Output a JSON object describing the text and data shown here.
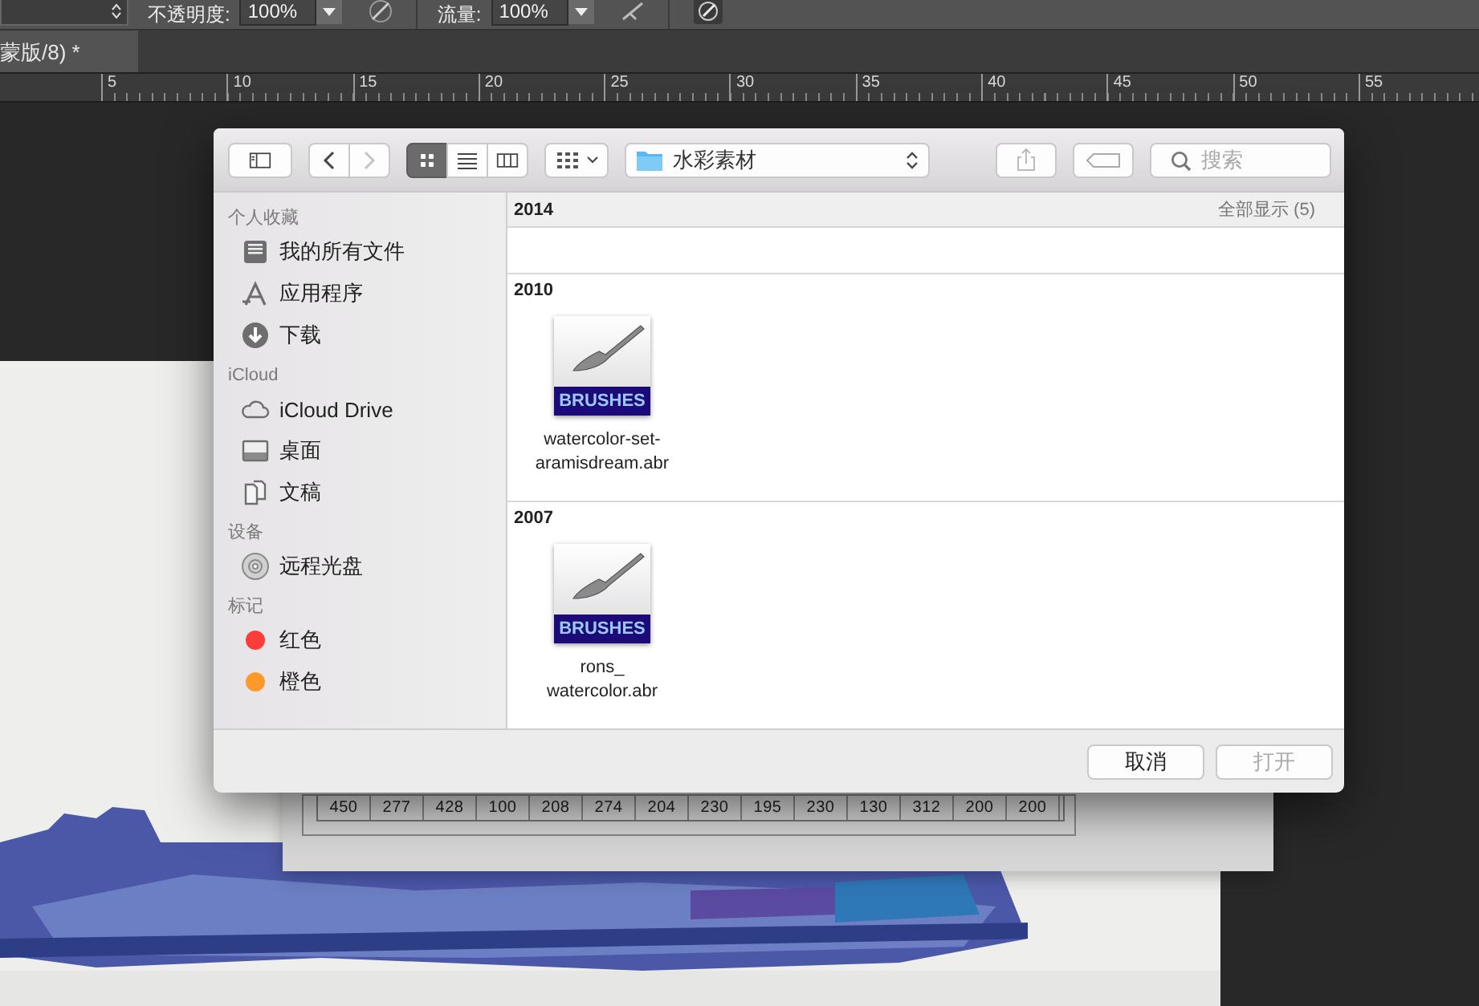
{
  "options_bar": {
    "opacity_label": "不透明度:",
    "opacity": "100%",
    "flow_label": "流量:",
    "flow": "100%"
  },
  "document_tab": {
    "title": "蒙版/8) *",
    "selected": true
  },
  "ruler": {
    "labels": [
      "5",
      "10",
      "15",
      "20",
      "25",
      "30",
      "35",
      "40",
      "45",
      "50",
      "55"
    ]
  },
  "background_table": {
    "cells": [
      "450",
      "277",
      "428",
      "100",
      "208",
      "274",
      "204",
      "230",
      "195",
      "230",
      "130",
      "312",
      "200",
      "200"
    ]
  },
  "dialog": {
    "navigation": [
      {
        "disabled": false
      },
      {
        "disabled": true
      }
    ],
    "views": [
      {
        "selected": true
      },
      {
        "selected": false
      },
      {
        "selected": false
      }
    ],
    "path": {
      "folder": "水彩素材"
    },
    "search": {
      "placeholder": "搜索"
    },
    "sidebar": [
      {
        "title": "个人收藏",
        "items": [
          {
            "kind": "place",
            "label": "我的所有文件"
          },
          {
            "kind": "place",
            "label": "应用程序"
          },
          {
            "kind": "place",
            "label": "下载"
          }
        ]
      },
      {
        "title": "iCloud",
        "items": [
          {
            "kind": "place",
            "label": "iCloud Drive"
          },
          {
            "kind": "place",
            "label": "桌面"
          },
          {
            "kind": "place",
            "label": "文稿"
          }
        ]
      },
      {
        "title": "设备",
        "items": [
          {
            "kind": "place",
            "label": "远程光盘"
          }
        ]
      },
      {
        "title": "标记",
        "items": [
          {
            "kind": "tag",
            "label": "红色",
            "color": "#fc3d39"
          },
          {
            "kind": "tag",
            "label": "橙色",
            "color": "#fd9a2b"
          }
        ]
      }
    ],
    "sticky_header": {
      "title": "2014",
      "show_all": "全部显示 (5)"
    },
    "groups": [
      {
        "title": "2010",
        "files": [
          {
            "icon_label": "BRUSHES",
            "name_lines": [
              "watercolor-set-",
              "aramisdream.abr"
            ]
          }
        ]
      },
      {
        "title": "2007",
        "files": [
          {
            "icon_label": "BRUSHES",
            "name_lines": [
              "rons_",
              "watercolor.abr"
            ]
          }
        ]
      }
    ],
    "buttons": [
      {
        "label": "取消",
        "disabled": false
      },
      {
        "label": "打开",
        "disabled": true
      }
    ]
  }
}
